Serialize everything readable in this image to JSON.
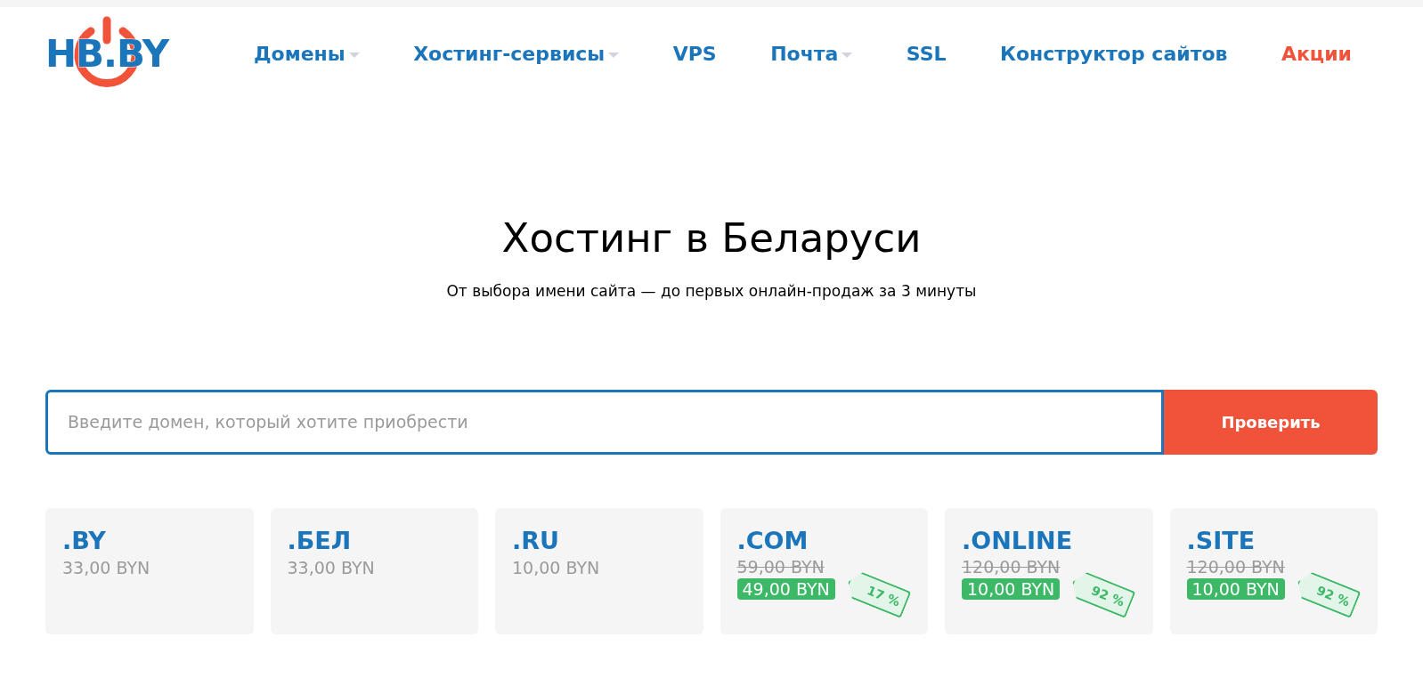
{
  "logo": {
    "text": "HB.BY"
  },
  "nav": [
    {
      "label": "Домены",
      "dropdown": true,
      "highlight": false
    },
    {
      "label": "Хостинг-сервисы",
      "dropdown": true,
      "highlight": false
    },
    {
      "label": "VPS",
      "dropdown": false,
      "highlight": false
    },
    {
      "label": "Почта",
      "dropdown": true,
      "highlight": false
    },
    {
      "label": "SSL",
      "dropdown": false,
      "highlight": false
    },
    {
      "label": "Конструктор сайтов",
      "dropdown": false,
      "highlight": false
    },
    {
      "label": "Акции",
      "dropdown": false,
      "highlight": true
    }
  ],
  "hero": {
    "title": "Хостинг в Беларуси",
    "subtitle": "От выбора имени сайта — до первых онлайн-продаж за 3 минуты"
  },
  "search": {
    "placeholder": "Введите домен, который хотите приобрести",
    "button": "Проверить"
  },
  "domains": [
    {
      "kind": "regular",
      "zone": ".BY",
      "price": "33,00 BYN"
    },
    {
      "kind": "regular",
      "zone": ".БЕЛ",
      "price": "33,00 BYN"
    },
    {
      "kind": "regular",
      "zone": ".RU",
      "price": "10,00 BYN"
    },
    {
      "kind": "sale",
      "zone": ".COM",
      "old_price": "59,00 BYN",
      "price": "49,00 BYN",
      "discount": "17 %"
    },
    {
      "kind": "sale",
      "zone": ".ONLINE",
      "old_price": "120,00 BYN",
      "price": "10,00 BYN",
      "discount": "92 %"
    },
    {
      "kind": "sale",
      "zone": ".SITE",
      "old_price": "120,00 BYN",
      "price": "10,00 BYN",
      "discount": "92 %"
    }
  ]
}
